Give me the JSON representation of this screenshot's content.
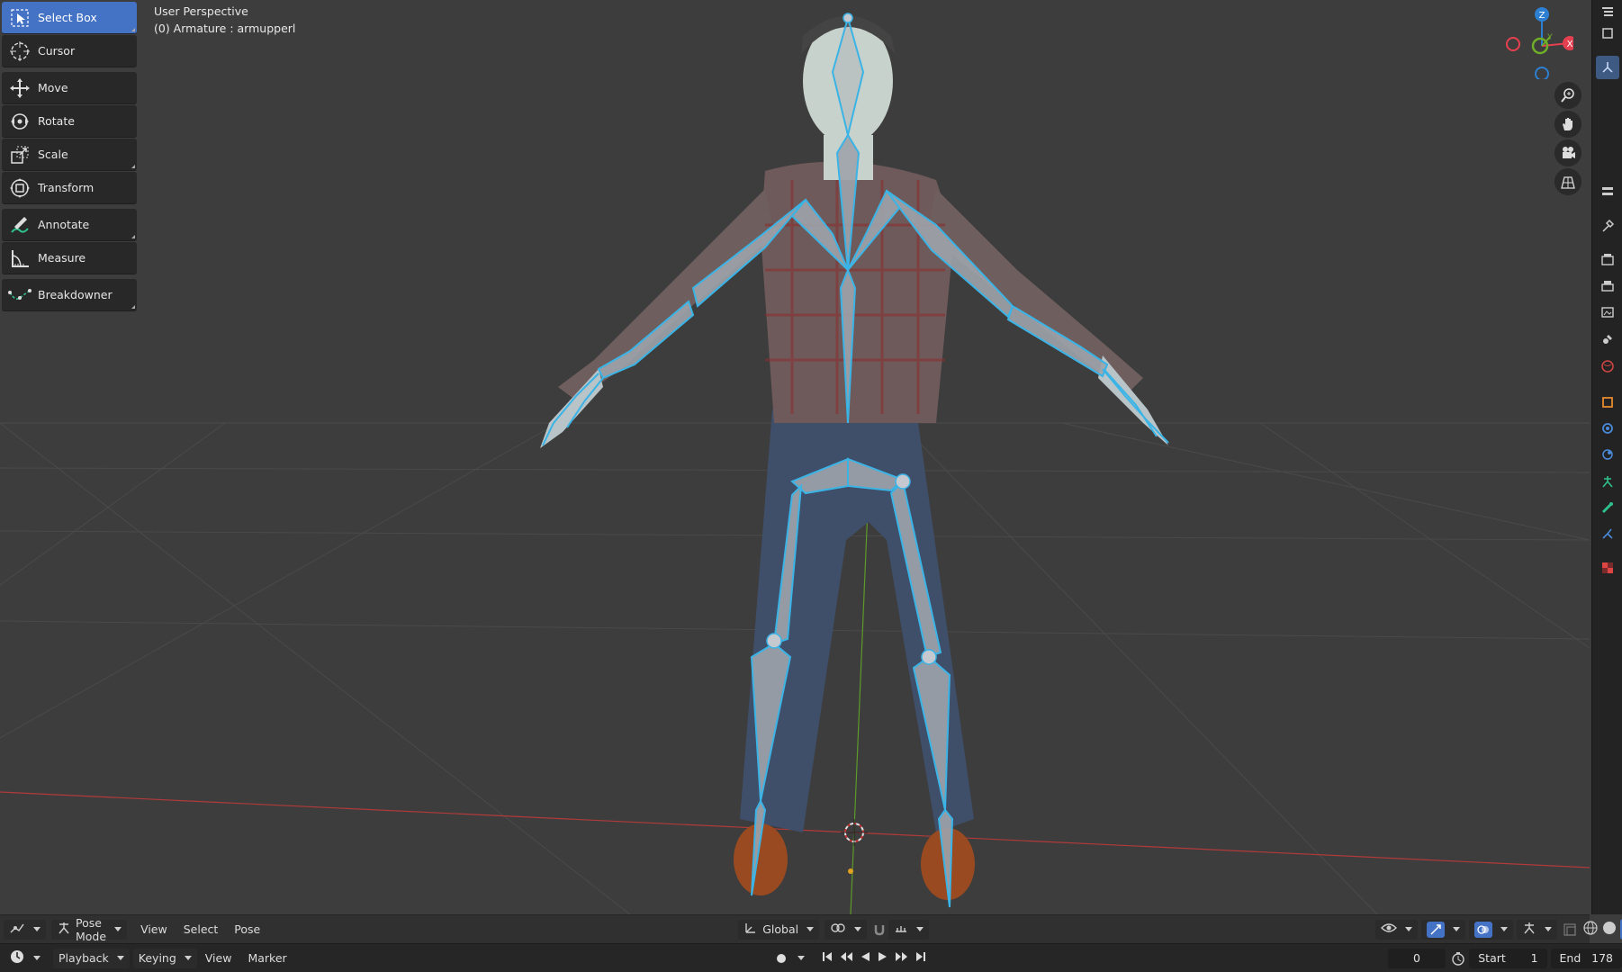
{
  "viewport": {
    "title": "User Perspective",
    "subtitle": "(0) Armature : armupperl"
  },
  "toolbar": {
    "groups": [
      [
        {
          "label": "Select Box",
          "icon": "select-box-icon",
          "active": true
        },
        {
          "label": "Cursor",
          "icon": "cursor-icon"
        }
      ],
      [
        {
          "label": "Move",
          "icon": "move-icon"
        },
        {
          "label": "Rotate",
          "icon": "rotate-icon"
        },
        {
          "label": "Scale",
          "icon": "scale-icon"
        },
        {
          "label": "Transform",
          "icon": "transform-icon"
        }
      ],
      [
        {
          "label": "Annotate",
          "icon": "annotate-icon"
        },
        {
          "label": "Measure",
          "icon": "measure-icon"
        }
      ],
      [
        {
          "label": "Breakdowner",
          "icon": "breakdowner-icon"
        }
      ]
    ]
  },
  "gizmo": {
    "axis_z": "Z",
    "axis_y": "Y",
    "axis_x": "X",
    "colors": {
      "x": "#e5404f",
      "y": "#6fae28",
      "z": "#2c7fd1"
    }
  },
  "header": {
    "mode": "Pose Mode",
    "menus": [
      "View",
      "Select",
      "Pose"
    ],
    "orientation": "Global"
  },
  "timeline": {
    "playback": "Playback",
    "keying": "Keying",
    "view": "View",
    "marker": "Marker",
    "current_frame": "0",
    "start_label": "Start",
    "start_value": "1",
    "end_label": "End",
    "end_value": "178"
  },
  "colors": {
    "accent": "#4472c4",
    "bone_outline": "#3ab4e6",
    "bone_fill": "#9da3ab",
    "background": "#3d3d3d"
  }
}
